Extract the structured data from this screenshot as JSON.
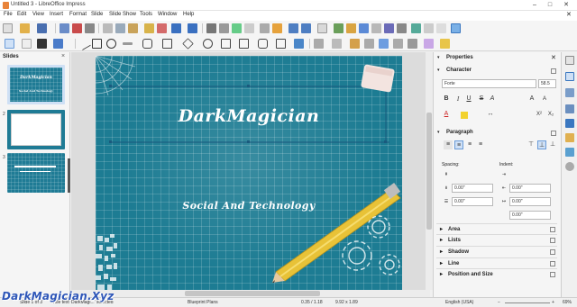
{
  "window": {
    "title": "Untitled 3 - LibreOffice Impress"
  },
  "menu": [
    "File",
    "Edit",
    "View",
    "Insert",
    "Format",
    "Slide",
    "Slide Show",
    "Tools",
    "Window",
    "Help"
  ],
  "slides_pane": {
    "header": "Slides",
    "close": "×",
    "numbers": [
      "1",
      "2",
      "3"
    ],
    "thumb1": {
      "title": "DarkMagician",
      "subtitle": "Social And Technology"
    }
  },
  "slide": {
    "title": "DarkMagician",
    "subtitle": "Social And Technology"
  },
  "watermark": "DarkMagician.Xyz",
  "properties": {
    "header": "Properties",
    "character": {
      "label": "Character",
      "font": "Forte",
      "size": "58.5"
    },
    "paragraph": {
      "label": "Paragraph",
      "spacing_label": "Spacing:",
      "indent_label": "Indent:",
      "spacing_above": "0.00\"",
      "spacing_below": "0.00\"",
      "indent_before": "0.00\"",
      "indent_after": "0.00\"",
      "indent_first": "0.00\"",
      "spacing_line": "0.00\""
    },
    "sections": [
      "Area",
      "Lists",
      "Shadow",
      "Line",
      "Position and Size"
    ]
  },
  "status": {
    "slide": "Slide 1 of 3",
    "layout": "Title text 'DarkMagi...' selected",
    "master": "Blueprint Plans",
    "position": "0.35 / 1.18",
    "size": "9.92 x 1.89",
    "language": "English (USA)",
    "zoom": "69%"
  },
  "colors": {
    "slide_bg": "#1d7c93",
    "accent_orange": "#e8833a",
    "font_red": "#cc2222",
    "highlight_yellow": "#f2d22e"
  }
}
